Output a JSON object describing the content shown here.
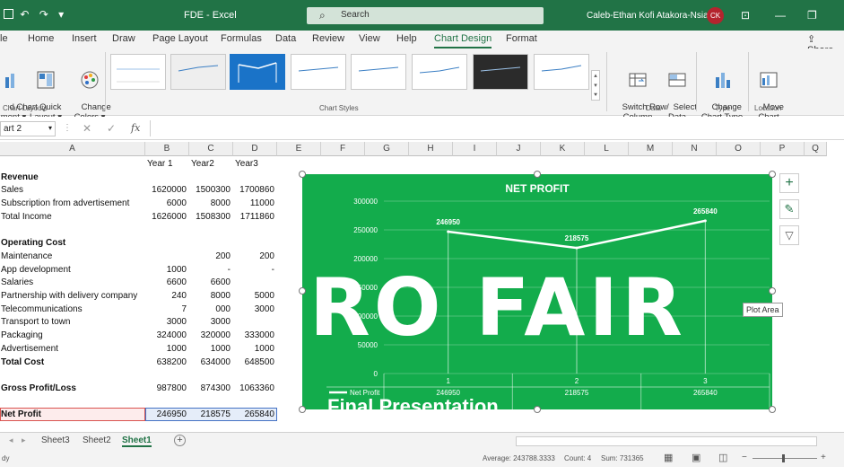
{
  "title_bar": {
    "quick_access": "↶ ↷ ▾",
    "doc_title": "FDE  -  Excel",
    "search_placeholder": "Search",
    "user_name": "Caleb-Ethan Kofi Atakora-Nsiah",
    "avatar_initials": "CK"
  },
  "tabs": [
    "le",
    "Home",
    "Insert",
    "Draw",
    "Page Layout",
    "Formulas",
    "Data",
    "Review",
    "View",
    "Help",
    "Chart Design",
    "Format"
  ],
  "share_label": "Share",
  "ribbon": {
    "add_chart": "d Chart\nment ▾",
    "quick_layout": "Quick\nLayout ▾",
    "change_colors": "Change\nColors ▾",
    "switch_row_col": "Switch Row/\nColumn",
    "select_data": "Select\nData",
    "change_chart_type": "Change\nChart Type",
    "move_chart": "Move\nChart",
    "groups": {
      "chart_layouts": "Chart Layouts",
      "chart_styles": "Chart Styles",
      "data": "Data",
      "type": "Type",
      "location": "Location"
    }
  },
  "formula_bar": {
    "name_box": "art 2",
    "fx": "fx",
    "value": ""
  },
  "columns": [
    "A",
    "B",
    "C",
    "D",
    "E",
    "F",
    "G",
    "H",
    "I",
    "J",
    "K",
    "L",
    "M",
    "N",
    "O",
    "P",
    "Q"
  ],
  "header_row": [
    "",
    "Year 1",
    "Year2",
    "Year3"
  ],
  "rows": [
    {
      "label": "Revenue",
      "bold": true,
      "values": [
        "",
        "",
        ""
      ]
    },
    {
      "label": "Sales",
      "values": [
        "1620000",
        "1500300",
        "1700860"
      ]
    },
    {
      "label": "Subscription from advertisement",
      "values": [
        "6000",
        "8000",
        "11000"
      ]
    },
    {
      "label": "Total Income",
      "values": [
        "1626000",
        "1508300",
        "1711860"
      ]
    },
    {
      "label": "",
      "values": [
        "",
        "",
        ""
      ]
    },
    {
      "label": "Operating Cost",
      "bold": true,
      "values": [
        "",
        "",
        ""
      ]
    },
    {
      "label": "Maintenance",
      "values": [
        "",
        "200",
        "200"
      ]
    },
    {
      "label": "App development",
      "values": [
        "1000",
        "-",
        "-"
      ]
    },
    {
      "label": "Salaries",
      "values": [
        "6600",
        "6600",
        ""
      ]
    },
    {
      "label": "Partnership with delivery company",
      "values": [
        "240",
        "8000",
        "5000"
      ]
    },
    {
      "label": "Telecommunications",
      "values": [
        "7",
        "000",
        "3000"
      ]
    },
    {
      "label": "Transport to town",
      "values": [
        "3000",
        "3000",
        ""
      ]
    },
    {
      "label": "Packaging",
      "values": [
        "324000",
        "320000",
        "333000"
      ]
    },
    {
      "label": "Advertisement",
      "values": [
        "1000",
        "1000",
        "1000"
      ]
    },
    {
      "label": "Total Cost",
      "bold": true,
      "values": [
        "638200",
        "634000",
        "648500"
      ]
    },
    {
      "label": "",
      "values": [
        "",
        "",
        ""
      ]
    },
    {
      "label": "Gross Profit/Loss",
      "bold": true,
      "values": [
        "987800",
        "874300",
        "1063360"
      ]
    },
    {
      "label": "",
      "values": [
        "",
        "",
        ""
      ]
    },
    {
      "label": "Net Profit",
      "bold": true,
      "values": [
        "246950",
        "218575",
        "265840"
      ]
    }
  ],
  "chart_data": {
    "type": "line",
    "title": "NET PROFIT",
    "categories": [
      "1",
      "2",
      "3"
    ],
    "series": [
      {
        "name": "Net Profit",
        "values": [
          246950,
          218575,
          265840
        ]
      }
    ],
    "yticks": [
      "0",
      "50000",
      "100000",
      "150000",
      "200000",
      "250000",
      "300000"
    ],
    "ylim": [
      0,
      300000
    ],
    "data_labels": [
      "246950",
      "218575",
      "265840"
    ],
    "data_table": true,
    "colors": {
      "background": "#13ac4c",
      "line": "#ffffff"
    }
  },
  "overlay": {
    "big_text": "RO  FAIR",
    "subtitle": "Final Presentation"
  },
  "tooltip": "Plot Area",
  "sheet_tabs": [
    "Sheet3",
    "Sheet2",
    "Sheet1"
  ],
  "status_bar": {
    "ready": "dy",
    "average": "Average: 243788.3333",
    "count": "Count: 4",
    "sum": "Sum: 731365"
  }
}
